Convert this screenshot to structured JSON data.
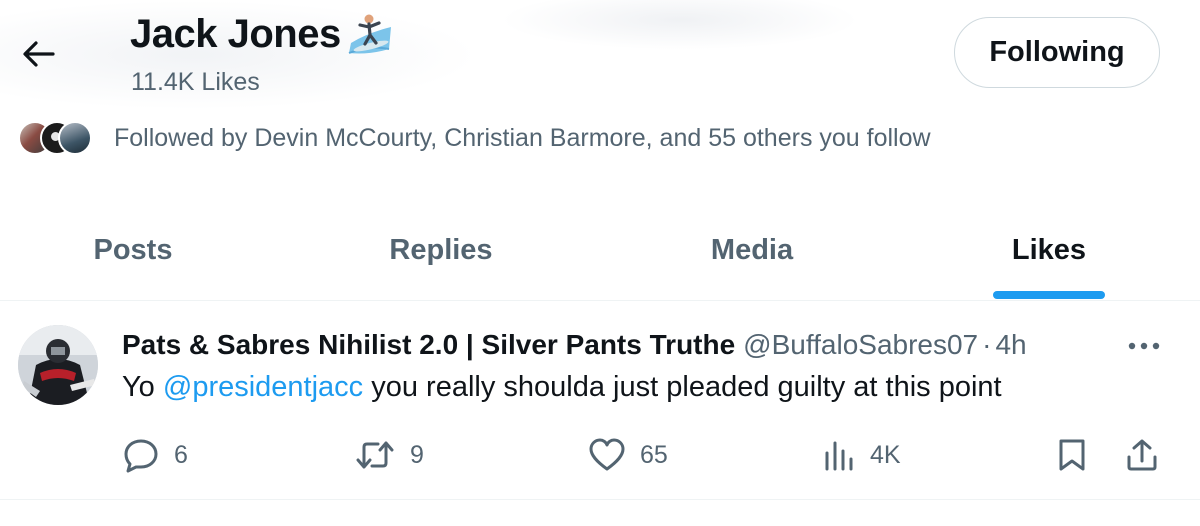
{
  "header": {
    "name": "Jack Jones",
    "likes_count": "11.4K Likes",
    "follow_button": "Following"
  },
  "followed_by": {
    "text": "Followed by Devin McCourty, Christian Barmore, and 55 others you follow"
  },
  "tabs": [
    {
      "label": "Posts"
    },
    {
      "label": "Replies"
    },
    {
      "label": "Media"
    },
    {
      "label": "Likes",
      "active": true
    }
  ],
  "tweet": {
    "author_name": "Pats & Sabres Nihilist 2.0 | Silver Pants Truthe",
    "handle": "@BuffaloSabres07",
    "separator": "·",
    "time": "4h",
    "body_before": "Yo ",
    "mention": "@presidentjacc",
    "body_after": " you really shoulda just pleaded guilty at this point",
    "actions": {
      "replies": "6",
      "reposts": "9",
      "likes": "65",
      "views": "4K"
    }
  },
  "colors": {
    "accent": "#1d9bf0",
    "text_primary": "#0f1419",
    "text_secondary": "#536471"
  },
  "icons": [
    "back-arrow-icon",
    "surfer-emoji-icon",
    "more-icon",
    "reply-icon",
    "repost-icon",
    "like-icon",
    "views-icon",
    "bookmark-icon",
    "share-icon"
  ]
}
